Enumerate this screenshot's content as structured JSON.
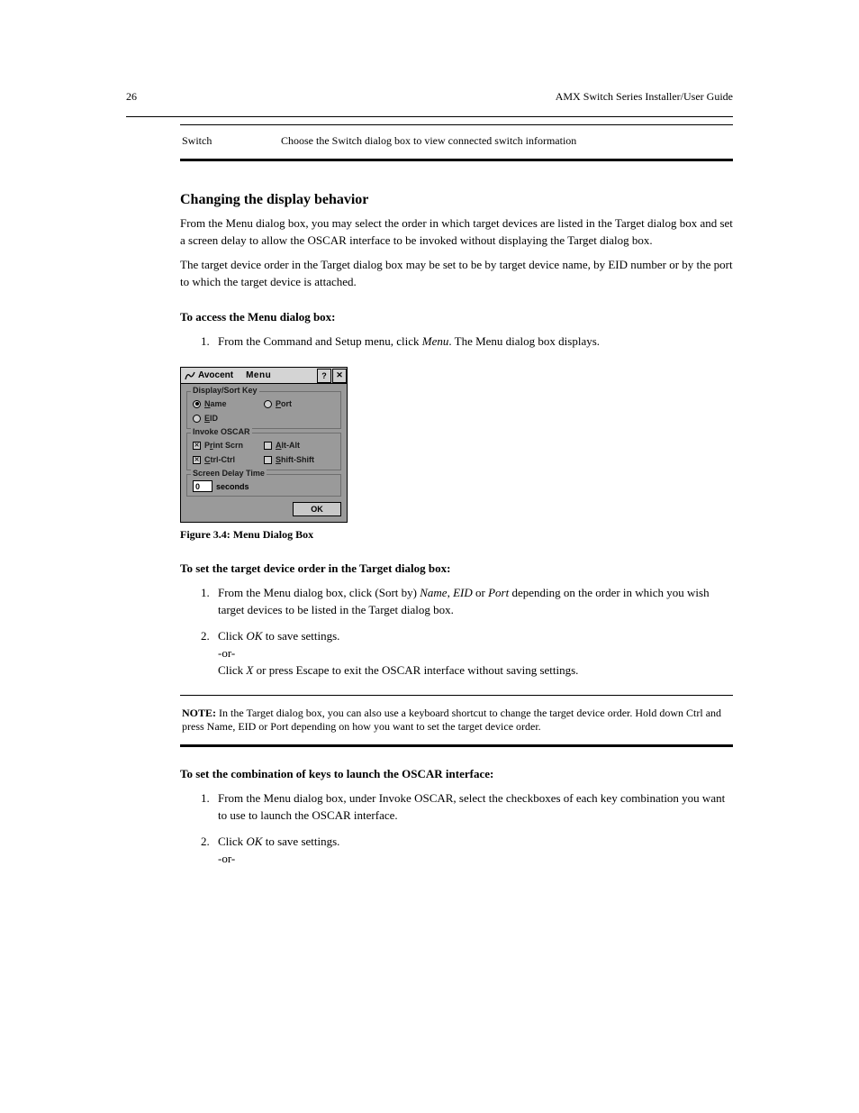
{
  "header": {
    "page_number": "26",
    "doc_title": "AMX Switch Series Installer/User Guide"
  },
  "config_table": {
    "feature": "Switch",
    "purpose": "Choose the Switch dialog box to view connected switch information"
  },
  "section": {
    "heading": "Changing the display behavior",
    "p1": "From the Menu dialog box, you may select the order in which target devices are listed in the Target dialog box and set a screen delay to allow the OSCAR interface to be invoked without displaying the Target dialog box.",
    "p2": "The target device order in the Target dialog box may be set to be by target device name, by EID number or by the port to which the target device is attached."
  },
  "proc1": {
    "heading": "To access the Menu dialog box:",
    "step1_a": "From the Command and Setup menu, click ",
    "step1_b": "Menu",
    "step1_c": ". The Menu dialog box displays."
  },
  "dialog": {
    "brand": "Avocent",
    "title": "Menu",
    "help_btn": "?",
    "close_btn": "✕",
    "display_sort": {
      "legend": "Display/Sort Key",
      "name_label": "Name",
      "port_label": "Port",
      "eid_label": "EID",
      "selected": "Name"
    },
    "invoke": {
      "legend": "Invoke OSCAR",
      "print_scrn": "Print Scrn",
      "alt_alt": "Alt-Alt",
      "ctrl_ctrl": "Ctrl-Ctrl",
      "shift_shift": "Shift-Shift",
      "print_scrn_checked": true,
      "ctrl_ctrl_checked": true,
      "alt_alt_checked": false,
      "shift_shift_checked": false
    },
    "delay": {
      "legend": "Screen Delay Time",
      "value": "0",
      "unit": "seconds"
    },
    "ok": "OK"
  },
  "figure_caption": "Figure 3.4: Menu Dialog Box",
  "proc2": {
    "heading": "To set the target device order in the Target dialog box:",
    "step1_a": "From the Menu dialog box, click (Sort by) ",
    "step1_b": "Name",
    "step1_c": ", ",
    "step1_d": "EID",
    "step1_e": " or ",
    "step1_f": "Port",
    "step1_g": " depending on the order in which you wish target devices to be listed in the Target dialog box.",
    "step2_a": "Click ",
    "step2_b": "OK",
    "step2_c": " to save settings.\n-or-\nClick ",
    "step2_d": "X",
    "step2_e": " or press ",
    "step2_f": "Escape",
    "step2_g": " to exit the OSCAR interface without saving settings."
  },
  "note": {
    "label": "NOTE:",
    "text": " In the Target dialog box, you can also use a keyboard shortcut to change the target device order. Hold down Ctrl and press Name, EID or Port depending on how you want to set the target device order."
  },
  "proc3": {
    "heading": "To set the combination of keys to launch the OSCAR interface:",
    "step1": "From the Menu dialog box, under Invoke OSCAR, select the checkboxes of each key combination you want to use to launch the OSCAR interface.",
    "step2_a": "Click ",
    "step2_b": "OK",
    "step2_c": " to save settings.\n-or-"
  }
}
